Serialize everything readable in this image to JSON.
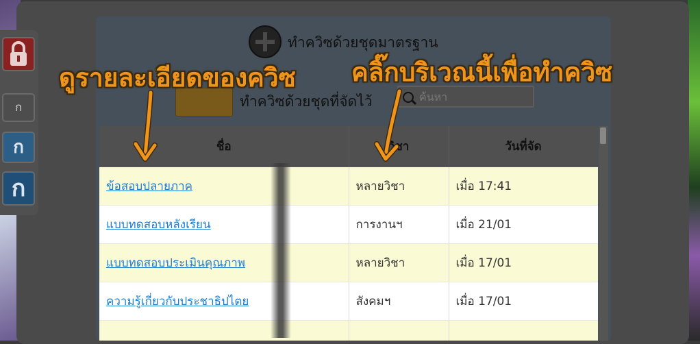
{
  "side": {
    "lock_icon": "lock-icon",
    "font_small": "ก",
    "font_medium": "ก",
    "font_large": "ก"
  },
  "quiz": {
    "standard_label": "ทำควิซด้วยชุดมาตรฐาน",
    "saved_label": "ทำควิซด้วยชุดที่จัดไว้",
    "search_placeholder": "ค้นหา"
  },
  "annotations": {
    "details": "ดูรายละเอียดของควิซ",
    "click_here": "คลิ๊กบริเวณนี้เพื่อทำควิซ"
  },
  "table": {
    "headers": [
      "ชื่อ",
      "วิชา",
      "วันที่จัด"
    ],
    "rows": [
      {
        "name": "ข้อสอบปลายภาค",
        "subject": "หลายวิชา",
        "date": "เมื่อ 17:41"
      },
      {
        "name": "แบบทดสอบหลังเรียน",
        "subject": "การงานฯ",
        "date": "เมื่อ 21/01"
      },
      {
        "name": "แบบทดสอบประเมินคุณภาพ",
        "subject": "หลายวิชา",
        "date": "เมื่อ 17/01"
      },
      {
        "name": "ความรู้เกี่ยวกับประชาธิปไตย",
        "subject": "สังคมฯ",
        "date": "เมื่อ 17/01"
      }
    ]
  },
  "colors": {
    "annotation": "#f0951b",
    "link": "#1e7ed0",
    "row_highlight": "#fafad4"
  }
}
